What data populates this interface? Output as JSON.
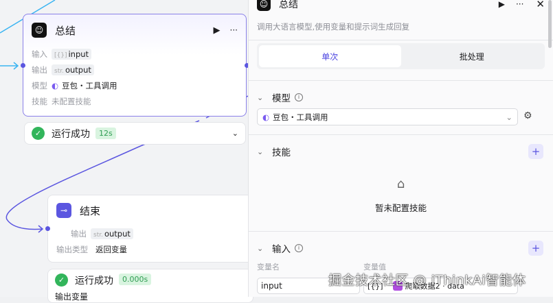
{
  "llm_node": {
    "title": "总结",
    "input_label": "输入",
    "input_type": "[{}]",
    "input_value": "input",
    "output_label": "输出",
    "output_type": "str.",
    "output_value": "output",
    "model_label": "模型",
    "model_value": "豆包・工具调用",
    "skill_label": "技能",
    "skill_value": "未配置技能",
    "status": "运行成功",
    "time": "12s"
  },
  "end_node": {
    "title": "结束",
    "output_label": "输出",
    "output_type": "str.",
    "output_value": "output",
    "output_kind_label": "输出类型",
    "output_kind_value": "返回变量",
    "status": "运行成功",
    "time": "0.000s",
    "output_vars_label": "输出变量"
  },
  "panel": {
    "title": "总结",
    "description": "调用大语言模型,使用变量和提示词生成回复",
    "tabs": [
      "单次",
      "批处理"
    ],
    "model_section": "模型",
    "model_value": "豆包・工具调用",
    "skills_section": "技能",
    "skills_empty": "暂未配置技能",
    "input_section": "输入",
    "var_name_header": "变量名",
    "var_value_header": "变量值",
    "var_name": "input",
    "var_type": "[{}]",
    "var_ref": "爬取数据2 · data"
  },
  "watermark": "掘金技术社区 @ iThinkAi智能体"
}
